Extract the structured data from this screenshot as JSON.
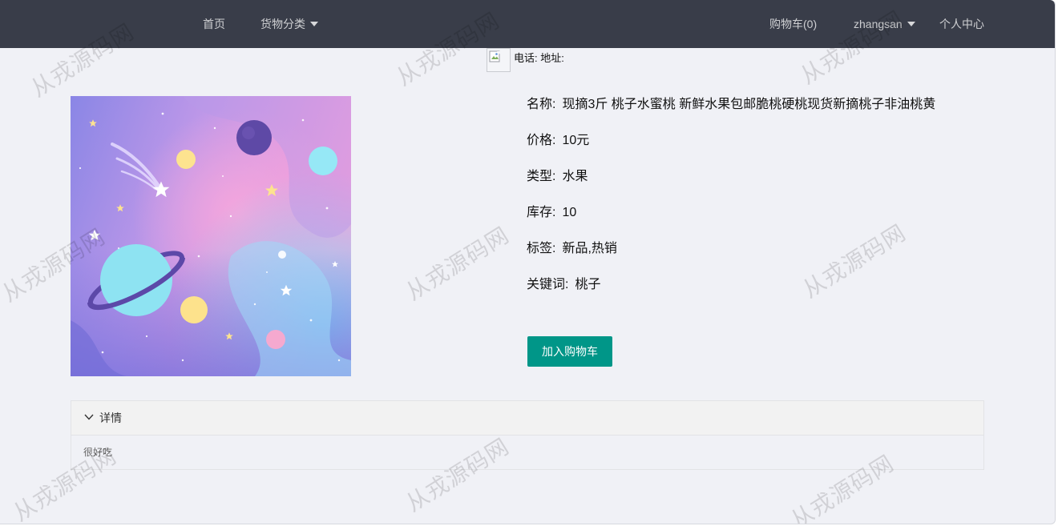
{
  "nav": {
    "home": "首页",
    "category": "货物分类",
    "cart": "购物车(0)",
    "user": "zhangsan",
    "profile": "个人中心"
  },
  "shop_info": "电话: 地址:",
  "product": {
    "fields": [
      {
        "label": "名称:",
        "value": "现摘3斤 桃子水蜜桃 新鲜水果包邮脆桃硬桃现货新摘桃子非油桃黄"
      },
      {
        "label": "价格:",
        "value": "10元"
      },
      {
        "label": "类型:",
        "value": "水果"
      },
      {
        "label": "库存:",
        "value": "10"
      },
      {
        "label": "标签:",
        "value": "新品,热销"
      },
      {
        "label": "关键词:",
        "value": "桃子"
      }
    ],
    "add_to_cart": "加入购物车"
  },
  "details": {
    "title": "详情",
    "content": "很好吃"
  },
  "watermark": "从戎源码网",
  "icons": {
    "nav_dropdown": "caret-down-icon",
    "details_toggle": "chevron-down-icon",
    "shop_logo": "broken-image-icon"
  },
  "colors": {
    "nav_bg": "#393d49",
    "accent": "#009688",
    "page_bg": "#f0f1f6"
  }
}
